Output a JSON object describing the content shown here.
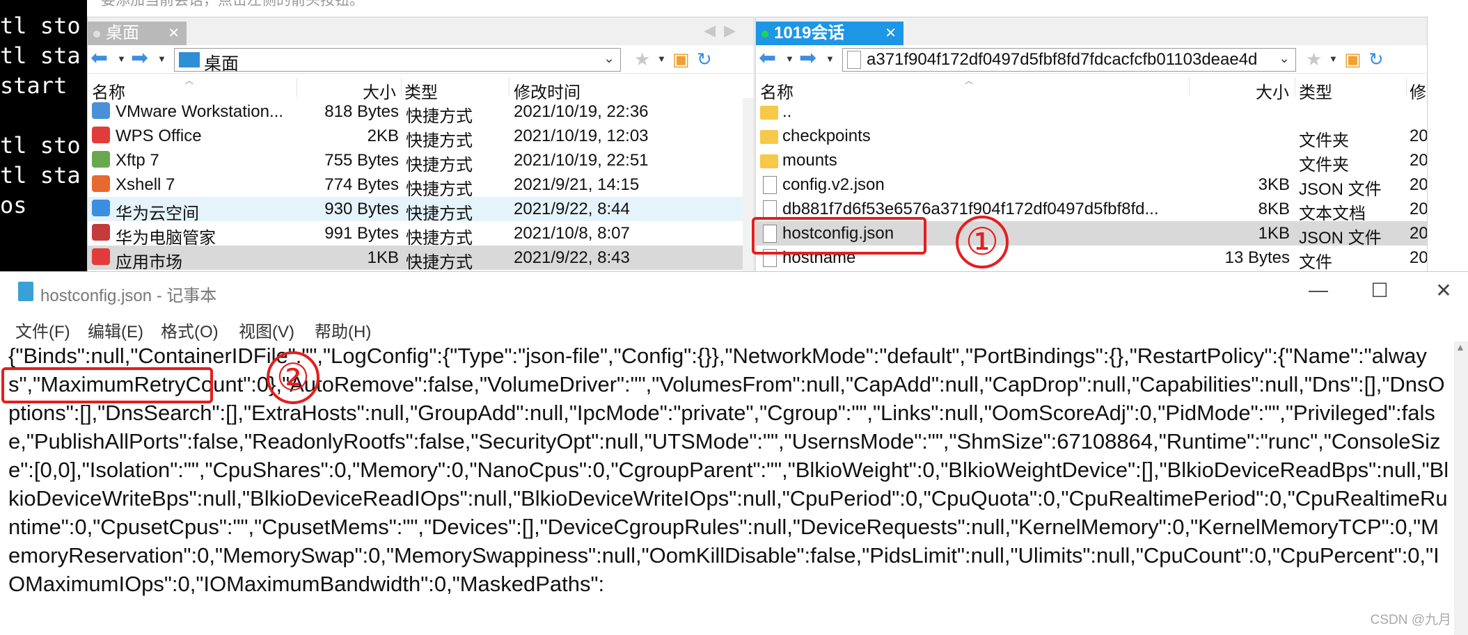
{
  "terminal": {
    "lines": [
      "tl sto",
      "tl sta",
      "start ",
      "",
      "tl sto",
      "tl sta",
      "os"
    ]
  },
  "hint": "要添加当前会话，点击左侧的箭头按钮。",
  "left_pane": {
    "tab_label": "桌面",
    "path": "桌面",
    "columns": {
      "name": "名称",
      "size": "大小",
      "type": "类型",
      "modified": "修改时间"
    },
    "rows": [
      {
        "name": "VMware Workstation...",
        "size": "818 Bytes",
        "type": "快捷方式",
        "modified": "2021/10/19, 22:36",
        "icon": "vmware-icon",
        "color": "#4a90d9"
      },
      {
        "name": "WPS Office",
        "size": "2KB",
        "type": "快捷方式",
        "modified": "2021/10/19, 12:03",
        "icon": "wps-icon",
        "color": "#e23b3b"
      },
      {
        "name": "Xftp 7",
        "size": "755 Bytes",
        "type": "快捷方式",
        "modified": "2021/10/19, 22:51",
        "icon": "xftp-icon",
        "color": "#6aa84f"
      },
      {
        "name": "Xshell 7",
        "size": "774 Bytes",
        "type": "快捷方式",
        "modified": "2021/9/21, 14:15",
        "icon": "xshell-icon",
        "color": "#e8692d"
      },
      {
        "name": "华为云空间",
        "size": "930 Bytes",
        "type": "快捷方式",
        "modified": "2021/9/22, 8:44",
        "icon": "cloud-icon",
        "color": "#3a8fe0"
      },
      {
        "name": "华为电脑管家",
        "size": "991 Bytes",
        "type": "快捷方式",
        "modified": "2021/10/8, 8:07",
        "icon": "pcmanager-icon",
        "color": "#c43b3b"
      },
      {
        "name": "应用市场",
        "size": "1KB",
        "type": "快捷方式",
        "modified": "2021/9/22, 8:43",
        "icon": "appstore-icon",
        "color": "#e23b3b"
      }
    ]
  },
  "right_pane": {
    "tab_label": "1019会话",
    "path": "a371f904f172df0497d5fbf8fd7fdcacfcfb01103deae4d",
    "columns": {
      "name": "名称",
      "size": "大小",
      "type": "类型",
      "modified": "修"
    },
    "rows": [
      {
        "name": "..",
        "size": "",
        "type": "",
        "modified": "",
        "icon": "folder-icon"
      },
      {
        "name": "checkpoints",
        "size": "",
        "type": "文件夹",
        "modified": "20",
        "icon": "folder-icon"
      },
      {
        "name": "mounts",
        "size": "",
        "type": "文件夹",
        "modified": "20",
        "icon": "folder-icon"
      },
      {
        "name": "config.v2.json",
        "size": "3KB",
        "type": "JSON 文件",
        "modified": "20",
        "icon": "file-icon"
      },
      {
        "name": "db881f7d6f53e6576a371f904f172df0497d5fbf8fd...",
        "size": "8KB",
        "type": "文本文档",
        "modified": "20",
        "icon": "file-icon"
      },
      {
        "name": "hostconfig.json",
        "size": "1KB",
        "type": "JSON 文件",
        "modified": "20",
        "icon": "file-icon"
      },
      {
        "name": "hostname",
        "size": "13 Bytes",
        "type": "文件",
        "modified": "20",
        "icon": "file-icon"
      }
    ]
  },
  "annotations": {
    "mark1": "①",
    "mark2": "②",
    "color": "#e51e1e"
  },
  "notepad": {
    "title": "hostconfig.json - 记事本",
    "menu": [
      "文件(F)",
      "编辑(E)",
      "格式(O)",
      "视图(V)",
      "帮助(H)"
    ],
    "content": "{\"Binds\":null,\"ContainerIDFile\":\"\",\"LogConfig\":{\"Type\":\"json-file\",\"Config\":{}},\"NetworkMode\":\"default\",\"PortBindings\":{},\"RestartPolicy\":{\"Name\":\"always\",\"MaximumRetryCount\":0},\"AutoRemove\":false,\"VolumeDriver\":\"\",\"VolumesFrom\":null,\"CapAdd\":null,\"CapDrop\":null,\"Capabilities\":null,\"Dns\":[],\"DnsOptions\":[],\"DnsSearch\":[],\"ExtraHosts\":null,\"GroupAdd\":null,\"IpcMode\":\"private\",\"Cgroup\":\"\",\"Links\":null,\"OomScoreAdj\":0,\"PidMode\":\"\",\"Privileged\":false,\"PublishAllPorts\":false,\"ReadonlyRootfs\":false,\"SecurityOpt\":null,\"UTSMode\":\"\",\"UsernsMode\":\"\",\"ShmSize\":67108864,\"Runtime\":\"runc\",\"ConsoleSize\":[0,0],\"Isolation\":\"\",\"CpuShares\":0,\"Memory\":0,\"NanoCpus\":0,\"CgroupParent\":\"\",\"BlkioWeight\":0,\"BlkioWeightDevice\":[],\"BlkioDeviceReadBps\":null,\"BlkioDeviceWriteBps\":null,\"BlkioDeviceReadIOps\":null,\"BlkioDeviceWriteIOps\":null,\"CpuPeriod\":0,\"CpuQuota\":0,\"CpuRealtimePeriod\":0,\"CpuRealtimeRuntime\":0,\"CpusetCpus\":\"\",\"CpusetMems\":\"\",\"Devices\":[],\"DeviceCgroupRules\":null,\"DeviceRequests\":null,\"KernelMemory\":0,\"KernelMemoryTCP\":0,\"MemoryReservation\":0,\"MemorySwap\":0,\"MemorySwappiness\":null,\"OomKillDisable\":false,\"PidsLimit\":null,\"Ulimits\":null,\"CpuCount\":0,\"CpuPercent\":0,\"IOMaximumIOps\":0,\"IOMaximumBandwidth\":0,\"MaskedPaths\":"
  },
  "watermark": "CSDN @九月"
}
